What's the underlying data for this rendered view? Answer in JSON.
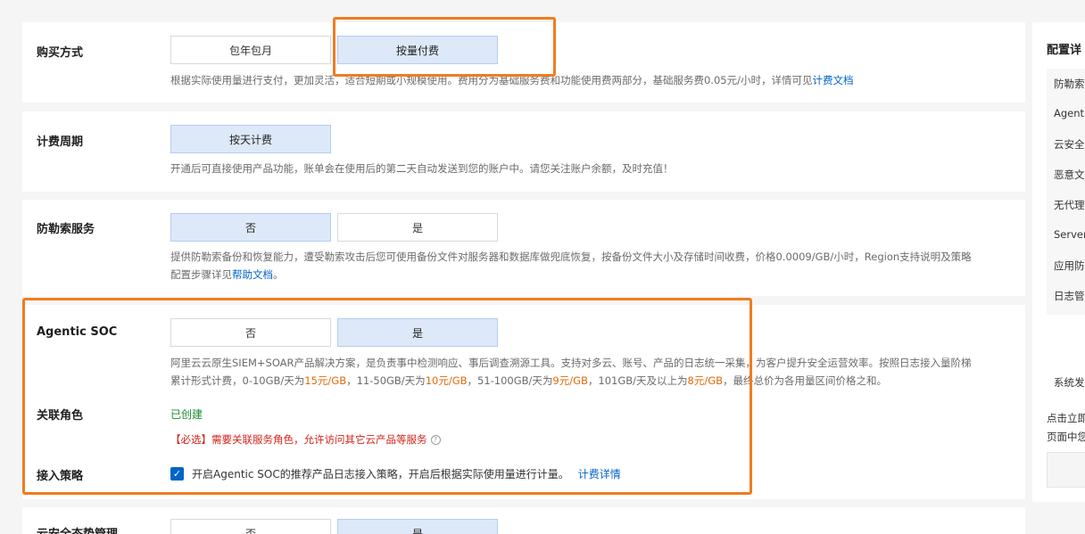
{
  "purchase": {
    "label": "购买方式",
    "options": [
      "包年包月",
      "按量付费"
    ],
    "desc": "根据实际使用量进行支付，更加灵活，适合短期或小规模使用。费用分为基础服务费和功能使用费两部分，基础服务费0.05元/小时，详情可见",
    "desc_link": "计费文档"
  },
  "billing_cycle": {
    "label": "计费周期",
    "option": "按天计费",
    "desc": "开通后可直接使用产品功能，账单会在使用后的第二天自动发送到您的账户中。请您关注账户余额，及时充值！"
  },
  "ransomware": {
    "label": "防勒索服务",
    "options": [
      "否",
      "是"
    ],
    "desc1": "提供防勒索备份和恢复能力，遭受勒索攻击后您可使用备份文件对服务器和数据库做兜底恢复，按备份文件大小及存储时间收费，价格0.0009/GB/小时，Region支持说明及策略",
    "desc2_prefix": "配置步骤详见",
    "desc2_link": "帮助文档",
    "desc2_suffix": "。"
  },
  "agentic": {
    "label": "Agentic SOC",
    "options": [
      "否",
      "是"
    ],
    "desc1": "阿里云云原生SIEM+SOAR产品解决方案，是负责事中检测响应、事后调查溯源工具。支持对多云、账号、产品的日志统一采集，为客户提升安全运营效率。按照日志接入量阶梯",
    "desc2_a": "累计形式计费，0-10GB/天为",
    "price1": "15元/GB",
    "desc2_b": "，11-50GB/天为",
    "price2": "10元/GB",
    "desc2_c": "，51-100GB/天为",
    "price3": "9元/GB",
    "desc2_d": "，101GB/天及以上为",
    "price4": "8元/GB",
    "desc2_e": "，最终总价为各用量区间价格之和。",
    "role_label": "关联角色",
    "role_status": "已创建",
    "role_required": "【必选】需要关联服务角色，允许访问其它云产品等服务",
    "policy_label": "接入策略",
    "policy_text": "开启Agentic SOC的推荐产品日志接入策略，开启后根据实际使用量进行计量。",
    "policy_link": "计费详情"
  },
  "cspm": {
    "label": "云安全态势管理",
    "options": [
      "否",
      "是"
    ]
  },
  "right_panel": {
    "title": "配置详",
    "items": [
      "防勒索",
      "Agenti",
      "云安全",
      "恶意文",
      "无代理",
      "Server",
      "应用防",
      "日志管"
    ],
    "system_label": "系统发",
    "note1": "点击立即",
    "note2": "页面中您"
  },
  "colors": {
    "accent": "#0064c8",
    "selected_bg": "#dde9f8",
    "highlight": "#f07c20",
    "price": "#e06a0a"
  }
}
